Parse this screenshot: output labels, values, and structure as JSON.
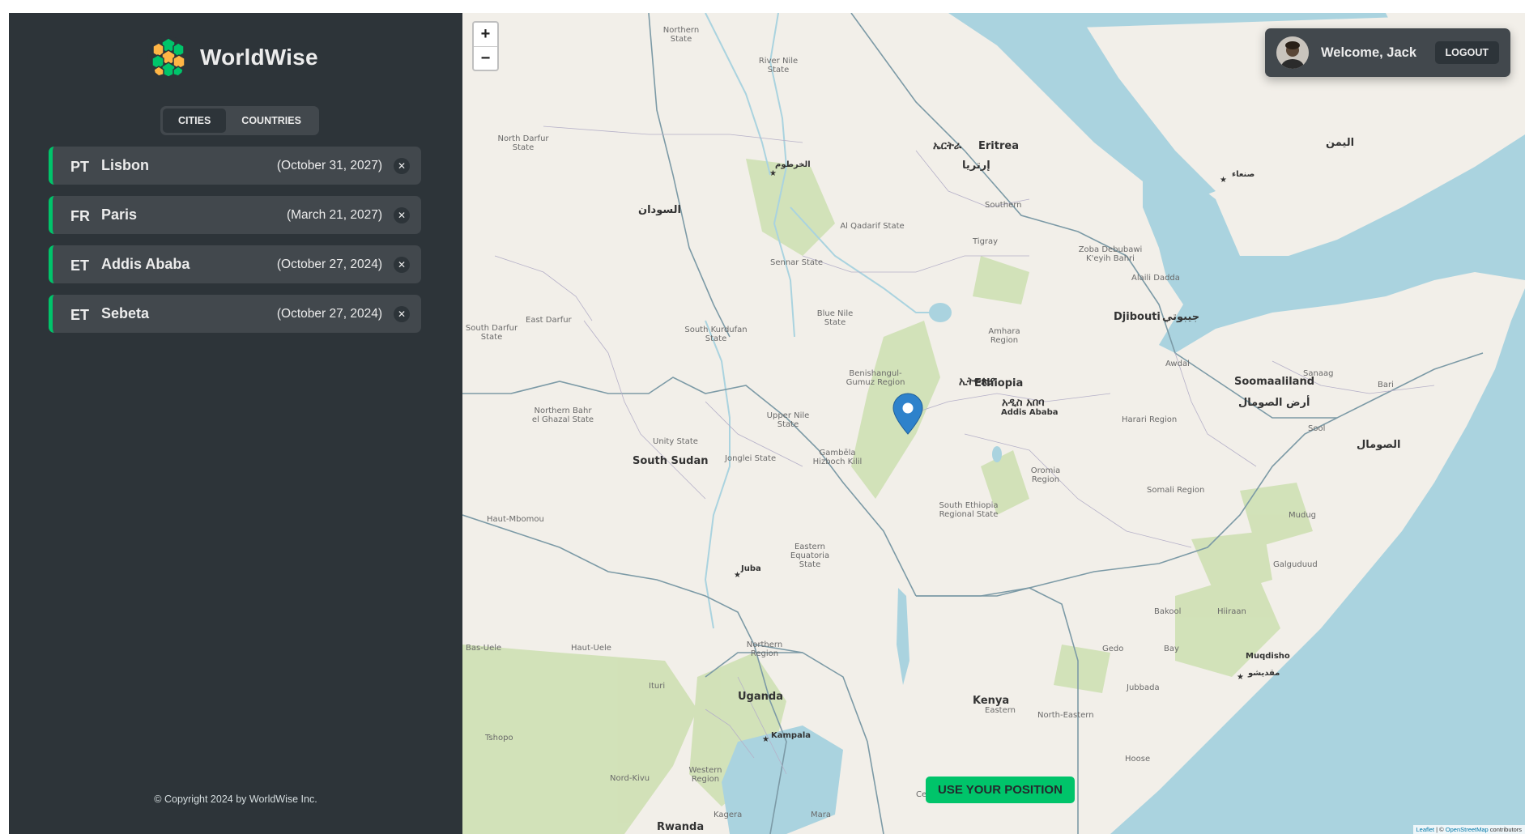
{
  "brand": {
    "name": "WorldWise"
  },
  "tabs": [
    {
      "label": "CITIES",
      "active": true
    },
    {
      "label": "COUNTRIES",
      "active": false
    }
  ],
  "cities": [
    {
      "code": "PT",
      "name": "Lisbon",
      "date": "(October 31, 2027)"
    },
    {
      "code": "FR",
      "name": "Paris",
      "date": "(March 21, 2027)"
    },
    {
      "code": "ET",
      "name": "Addis Ababa",
      "date": "(October 27, 2024)"
    },
    {
      "code": "ET",
      "name": "Sebeta",
      "date": "(October 27, 2024)"
    }
  ],
  "footer": {
    "copyright": "© Copyright 2024 by WorldWise Inc."
  },
  "map": {
    "zoom_in": "+",
    "zoom_out": "−",
    "use_position": "USE YOUR POSITION",
    "attribution": {
      "leaflet": "Leaflet",
      "separator": " | © ",
      "osm": "OpenStreetMap",
      "suffix": " contributors"
    },
    "labels": {
      "eritrea": "Eritrea",
      "eritrea_native": "ኤርትራ",
      "eritrea_ar": "إرتريا",
      "ethiopia": "Ethiopia",
      "ethiopia_native": "ኢትዮጵያ",
      "addis": "Addis Ababa",
      "addis_native": "አዲስ አበባ",
      "djibouti": "Djibouti",
      "djibouti_ar": "جيبوتي",
      "somaliland": "Soomaaliland",
      "somaliland_ar": "أرض الصومال",
      "somalia_ar": "الصومال",
      "yemen_ar": "اليمن",
      "sudan_ar": "السودان",
      "khartoum_ar": "الخرطوم",
      "south_sudan": "South Sudan",
      "juba": "Juba",
      "uganda": "Uganda",
      "kampala": "Kampala",
      "kenya": "Kenya",
      "rwanda": "Rwanda",
      "muqdisho": "Muqdisho",
      "muqdisho_ar": "مقديشو",
      "sanaa_ar": "صنعاء",
      "amhara": "Amhara Region",
      "oromia": "Oromia Region",
      "tigray": "Tigray",
      "somali": "Somali Region",
      "harari": "Harari Region",
      "south_eth": "South Ethiopia Regional State",
      "benishangul": "Benishangul-Gumuz Region",
      "gambela": "Gambēla Hizboch Kilil",
      "river_nile": "River Nile State",
      "northern_state": "Northern State",
      "north_darfur": "North Darfur State",
      "south_darfur": "South Darfur State",
      "east_darfur": "East Darfur",
      "south_kurdufan": "South Kurdufan State",
      "sennar": "Sennar State",
      "blue_nile": "Blue Nile State",
      "al_qadarif": "Al Qadarif State",
      "upper_nile": "Upper Nile State",
      "unity": "Unity State",
      "jonglei": "Jonglei State",
      "n_bahr": "Northern Bahr el Ghazal State",
      "eastern_eq": "Eastern Equatoria State",
      "haut_mbomou": "Haut-Mbomou",
      "haut_uele": "Haut-Uele",
      "bas_uele": "Bas-Uele",
      "northern_region": "Northern Region",
      "western": "Western Region",
      "eastern": "Eastern",
      "north_eastern": "North-Eastern",
      "afar": "Awdal",
      "sanaag": "Sanaag",
      "bari": "Bari",
      "sool": "Sool",
      "galgaduud": "Galguduud",
      "mudug": "Mudug",
      "hiiraan": "Hiiraan",
      "bakool": "Bakool",
      "bay": "Bay",
      "gedo": "Gedo",
      "jubbada": "Jubbada",
      "hoose": "Hoose",
      "ituri": "Ituri",
      "tshopo": "Tshopo",
      "nord_kivu": "Nord-Kivu",
      "kagera": "Kagera",
      "mara": "Mara",
      "central": "Central",
      "zoba": "Zoba Debubawi K'eyih Bahri",
      "southern": "Southern",
      "alaili": "Alaili Dadda"
    }
  },
  "user": {
    "welcome": "Welcome, Jack",
    "logout": "LOGOUT"
  },
  "colors": {
    "sidebar_bg": "#2d3439",
    "item_bg": "#42484d",
    "brand_green": "#00c46a",
    "water": "#aad3df",
    "land": "#f2efe9"
  },
  "icons": {
    "logo": "globe-hexagon-logo",
    "delete": "close-icon",
    "marker": "map-pin-icon",
    "capital": "star-icon"
  }
}
